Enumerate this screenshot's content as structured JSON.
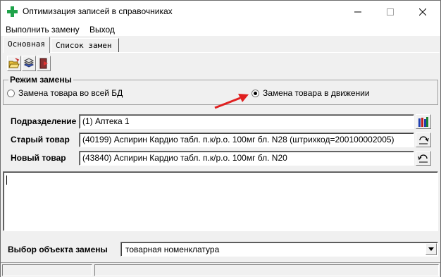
{
  "window": {
    "title": "Оптимизация записей в справочниках",
    "controls": {
      "minimize": "—",
      "maximize": "☐",
      "close": "✕"
    }
  },
  "menu": {
    "items": [
      {
        "label": "Выполнить замену"
      },
      {
        "label": "Выход"
      }
    ]
  },
  "tabs": [
    {
      "label": "Основная",
      "active": true
    },
    {
      "label": "Список замен",
      "active": false
    }
  ],
  "toolbar": {
    "icons": [
      "open-folder-icon",
      "stack-icon",
      "exit-door-icon"
    ]
  },
  "replace_mode": {
    "label": "Режим замены",
    "options": [
      {
        "label": "Замена товара во всей БД",
        "checked": false
      },
      {
        "label": "Замена товара в движении",
        "checked": true
      }
    ]
  },
  "fields": {
    "department": {
      "label": "Подразделение",
      "value": "(1) Аптека 1"
    },
    "old_product": {
      "label": "Старый товар",
      "value": "(40199) Аспирин Кардио табл. п.к/р.о. 100мг бл. N28 (штрихкод=200100002005)"
    },
    "new_product": {
      "label": "Новый товар",
      "value": "(43840) Аспирин Кардио табл. п.к/р.о. 100мг бл. N20"
    }
  },
  "memo": {
    "text": ""
  },
  "object_select": {
    "label": "Выбор объекта замены",
    "value": "товарная номенклатура"
  },
  "colors": {
    "arrow": "#e02020",
    "window_bg": "#f0f0f0"
  }
}
